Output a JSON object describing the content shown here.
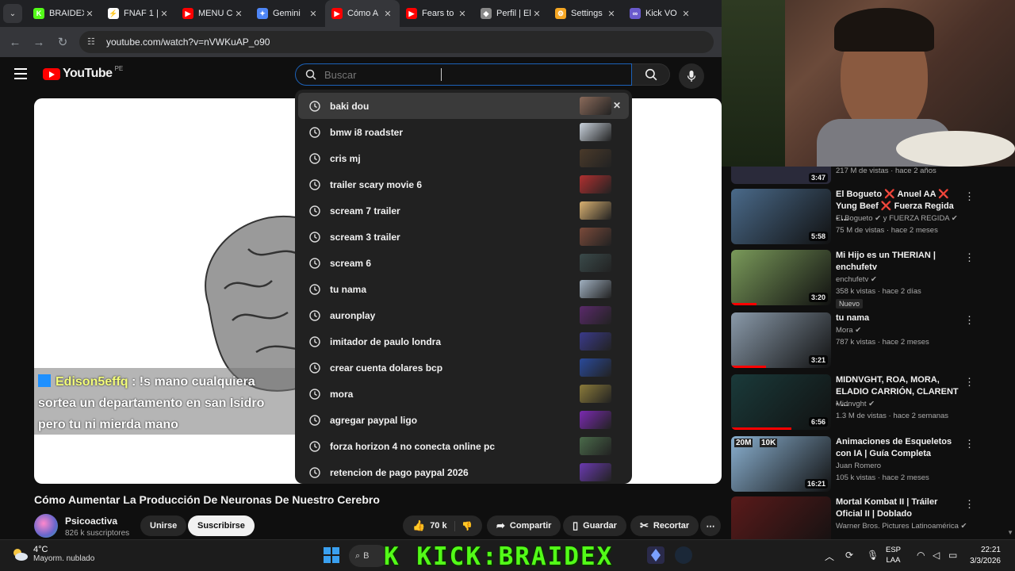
{
  "browser": {
    "tabs": [
      {
        "title": "BRAIDEX",
        "color": "#53fc18",
        "glyph": "K"
      },
      {
        "title": "FNAF 1 | ",
        "color": "#ffffff",
        "glyph": "⚡"
      },
      {
        "title": "MENU C",
        "color": "#ff0000",
        "glyph": "▶"
      },
      {
        "title": "Gemini",
        "color": "#4e86f7",
        "glyph": "✦"
      },
      {
        "title": "Cómo A",
        "color": "#ff0000",
        "glyph": "▶",
        "active": true
      },
      {
        "title": "Fears to",
        "color": "#ff0000",
        "glyph": "▶"
      },
      {
        "title": "Perfil | El",
        "color": "#888888",
        "glyph": "◆"
      },
      {
        "title": "Settings",
        "color": "#f5a623",
        "glyph": "⚙"
      },
      {
        "title": "Kick VO",
        "color": "#6a5acd",
        "glyph": "∞"
      }
    ],
    "url": "youtube.com/watch?v=nVWKuAP_o90"
  },
  "header": {
    "logo_text": "YouTube",
    "region": "PE",
    "search_placeholder": "Buscar"
  },
  "suggestions": [
    {
      "text": "baki dou",
      "thumb": "#8a6a5a"
    },
    {
      "text": "bmw i8 roadster",
      "thumb": "#c9d2dc"
    },
    {
      "text": "cris mj",
      "thumb": "#4a3a2a"
    },
    {
      "text": "trailer scary movie 6",
      "thumb": "#b03030"
    },
    {
      "text": "scream 7 trailer",
      "thumb": "#d8b070"
    },
    {
      "text": "scream 3 trailer",
      "thumb": "#7a4a3a"
    },
    {
      "text": "scream 6",
      "thumb": "#3a4a4a"
    },
    {
      "text": "tu nama",
      "thumb": "#a0b0c0"
    },
    {
      "text": "auronplay",
      "thumb": "#5a2a6a"
    },
    {
      "text": "imitador de paulo londra",
      "thumb": "#3a3a8a"
    },
    {
      "text": "crear cuenta dolares bcp",
      "thumb": "#2a4a9a"
    },
    {
      "text": "mora",
      "thumb": "#8a7a3a"
    },
    {
      "text": "agregar paypal ligo",
      "thumb": "#7a2ab0"
    },
    {
      "text": "forza horizon 4 no conecta online pc",
      "thumb": "#4a6a4a"
    },
    {
      "text": "retencion de pago paypal 2026",
      "thumb": "#6a3ab0"
    }
  ],
  "chat": {
    "user": "Edison5effq",
    "message_line1": ": !s mano cualquiera",
    "message_line2": "sortea un departamento en san Isidro",
    "message_line3": "pero tu ni mierda mano"
  },
  "video": {
    "title": "Cómo Aumentar La Producción De Neuronas De Nuestro Cerebro",
    "channel": "Psicoactiva",
    "subscribers": "826 k suscriptores",
    "join_label": "Unirse",
    "subscribe_label": "Suscribirse",
    "likes": "70 k",
    "share_label": "Compartir",
    "save_label": "Guardar",
    "clip_label": "Recortar"
  },
  "sidebar": {
    "top_meta": "217 M de vistas · hace 2 años",
    "top_duration": "3:47",
    "items": [
      {
        "title": "El Bogueto ❌ Anuel AA ❌ Yung Beef ❌ Fuerza Regida - ...",
        "channel": "El Bogueto ✔ y FUERZA REGIDA ✔",
        "meta": "75 M de vistas · hace 2 meses",
        "duration": "5:58",
        "thumb": "#4a6a8a"
      },
      {
        "title": "Mi Hijo es un THERIAN | enchufetv",
        "channel": "enchufetv ✔",
        "meta": "358 k vistas · hace 2 días",
        "duration": "3:20",
        "badge": "Nuevo",
        "thumb": "#7a9a5a"
      },
      {
        "title": "tu nama",
        "channel": "Mora ✔",
        "meta": "787 k vistas · hace 2 meses",
        "duration": "3:21",
        "thumb": "#8a9aaa"
      },
      {
        "title": "MIDNVGHT, ROA, MORA, ELADIO CARRIÓN, CLARENT - ...",
        "channel": "Midnvght ✔",
        "meta": "1.3 M de vistas · hace 2 semanas",
        "duration": "6:56",
        "thumb": "#1a3a3a"
      },
      {
        "title": "Animaciones de Esqueletos con IA | Guía Completa",
        "channel": "Juan Romero",
        "meta": "105 k vistas · hace 2 meses",
        "duration": "16:21",
        "thumb": "#8ab0d0"
      },
      {
        "title": "Mortal Kombat II | Tráiler Oficial II | Doblado",
        "channel": "Warner Bros. Pictures Latinoamérica ✔",
        "meta": "",
        "duration": "",
        "thumb": "#5a1a1a"
      }
    ],
    "skeleton_labels": [
      "20M",
      "10K"
    ]
  },
  "taskbar": {
    "temp": "4°C",
    "condition": "Mayorm. nublado",
    "search_text": "B",
    "banner": "K KICK:BRAIDEX",
    "lang1": "ESP",
    "lang2": "LAA",
    "time": "22:21",
    "date": "3/3/2026"
  },
  "colors": {
    "accent_red": "#ff0000",
    "kick_green": "#53fc18",
    "search_border": "#1c62b9"
  }
}
